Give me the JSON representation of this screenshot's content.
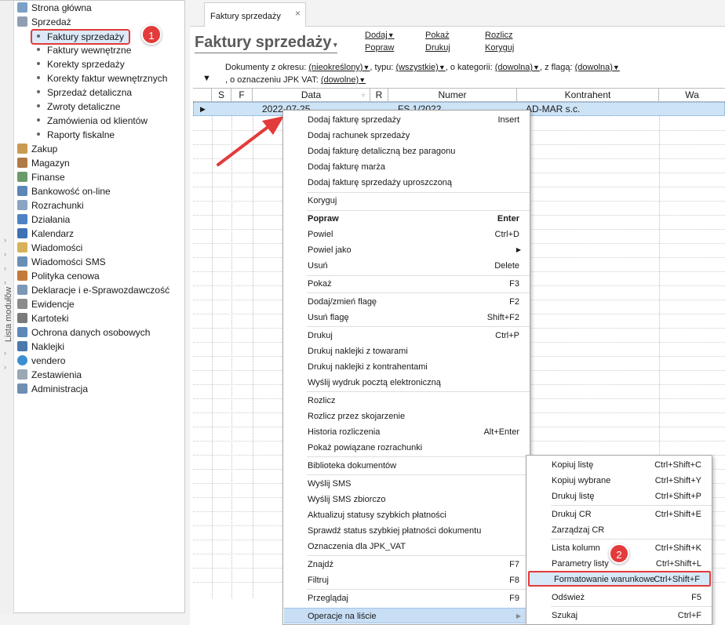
{
  "sidebar": {
    "rail_label": "Lista modułów",
    "modules": [
      {
        "label": "Strona główna",
        "icon": "home-icon"
      },
      {
        "label": "Sprzedaż",
        "icon": "sales-icon"
      },
      {
        "label": "Zakup",
        "icon": "purchase-icon"
      },
      {
        "label": "Magazyn",
        "icon": "warehouse-icon"
      },
      {
        "label": "Finanse",
        "icon": "finance-icon"
      },
      {
        "label": "Bankowość on-line",
        "icon": "bank-icon"
      },
      {
        "label": "Rozrachunki",
        "icon": "settlements-icon"
      },
      {
        "label": "Działania",
        "icon": "actions-icon"
      },
      {
        "label": "Kalendarz",
        "icon": "calendar-icon"
      },
      {
        "label": "Wiadomości",
        "icon": "mail-icon"
      },
      {
        "label": "Wiadomości SMS",
        "icon": "sms-icon"
      },
      {
        "label": "Polityka cenowa",
        "icon": "price-icon"
      },
      {
        "label": "Deklaracje i e-Sprawozdawczość",
        "icon": "declarations-icon"
      },
      {
        "label": "Ewidencje",
        "icon": "records-icon"
      },
      {
        "label": "Kartoteki",
        "icon": "files-icon"
      },
      {
        "label": "Ochrona danych osobowych",
        "icon": "privacy-icon"
      },
      {
        "label": "Naklejki",
        "icon": "stickers-icon"
      },
      {
        "label": "vendero",
        "icon": "vendero-icon"
      },
      {
        "label": "Zestawienia",
        "icon": "reports-icon"
      },
      {
        "label": "Administracja",
        "icon": "admin-icon"
      }
    ],
    "sales_items": [
      "Faktury sprzedaży",
      "Faktury wewnętrzne",
      "Korekty sprzedaży",
      "Korekty faktur wewnętrznych",
      "Sprzedaż detaliczna",
      "Zwroty detaliczne",
      "Zamówienia od klientów",
      "Raporty fiskalne"
    ]
  },
  "badges": {
    "first": "1",
    "second": "2"
  },
  "tab": {
    "label": "Faktury sprzedaży",
    "close": "×"
  },
  "main": {
    "title": "Faktury sprzedaży",
    "toolbar": [
      "Dodaj",
      "Popraw",
      "Pokaż",
      "Drukuj",
      "Rozlicz",
      "Koryguj"
    ],
    "filter_line1": {
      "label_period": "Dokumenty z okresu:",
      "period": "(nieokreślony)",
      "label_type": ", typu:",
      "type": "(wszystkie)",
      "label_category": ", o kategorii:",
      "category": "(dowolna)",
      "label_flag": ", z flagą:",
      "flag": "(dowolna)"
    },
    "filter_line2": {
      "label_jpk": ", o oznaczeniu JPK VAT:",
      "jpk": "(dowolne)"
    }
  },
  "grid": {
    "columns": [
      "S",
      "F",
      "Data",
      "R",
      "Numer",
      "Kontrahent",
      "Wa"
    ],
    "rows": [
      {
        "data": "2022-07-25",
        "numer": "FS 1/2022",
        "kontrahent": "AD-MAR s.c."
      }
    ]
  },
  "context_menu": {
    "items": [
      {
        "label": "Dodaj fakturę sprzedaży",
        "shortcut": "Insert"
      },
      {
        "label": "Dodaj rachunek sprzedaży",
        "shortcut": ""
      },
      {
        "label": "Dodaj fakturę detaliczną bez paragonu",
        "shortcut": ""
      },
      {
        "label": "Dodaj fakturę marża",
        "shortcut": ""
      },
      {
        "label": "Dodaj fakturę sprzedaży uproszczoną",
        "shortcut": ""
      },
      {
        "label": "Koryguj",
        "shortcut": ""
      },
      {
        "label": "Popraw",
        "shortcut": "Enter"
      },
      {
        "label": "Powiel",
        "shortcut": "Ctrl+D"
      },
      {
        "label": "Powiel jako",
        "shortcut": ""
      },
      {
        "label": "Usuń",
        "shortcut": "Delete"
      },
      {
        "label": "Pokaż",
        "shortcut": "F3"
      },
      {
        "label": "Dodaj/zmień flagę",
        "shortcut": "F2"
      },
      {
        "label": "Usuń flagę",
        "shortcut": "Shift+F2"
      },
      {
        "label": "Drukuj",
        "shortcut": "Ctrl+P"
      },
      {
        "label": "Drukuj naklejki z towarami",
        "shortcut": ""
      },
      {
        "label": "Drukuj naklejki z kontrahentami",
        "shortcut": ""
      },
      {
        "label": "Wyślij wydruk pocztą elektroniczną",
        "shortcut": ""
      },
      {
        "label": "Rozlicz",
        "shortcut": ""
      },
      {
        "label": "Rozlicz przez skojarzenie",
        "shortcut": ""
      },
      {
        "label": "Historia rozliczenia",
        "shortcut": "Alt+Enter"
      },
      {
        "label": "Pokaż powiązane rozrachunki",
        "shortcut": ""
      },
      {
        "label": "Biblioteka dokumentów",
        "shortcut": ""
      },
      {
        "label": "Wyślij SMS",
        "shortcut": ""
      },
      {
        "label": "Wyślij SMS zbiorczo",
        "shortcut": ""
      },
      {
        "label": "Aktualizuj statusy szybkich płatności",
        "shortcut": ""
      },
      {
        "label": "Sprawdź status szybkiej płatności dokumentu",
        "shortcut": ""
      },
      {
        "label": "Oznaczenia dla JPK_VAT",
        "shortcut": ""
      },
      {
        "label": "Znajdź",
        "shortcut": "F7"
      },
      {
        "label": "Filtruj",
        "shortcut": "F8"
      },
      {
        "label": "Przeglądaj",
        "shortcut": "F9"
      },
      {
        "label": "Operacje na liście",
        "shortcut": ""
      }
    ]
  },
  "submenu": {
    "items": [
      {
        "label": "Kopiuj listę",
        "shortcut": "Ctrl+Shift+C"
      },
      {
        "label": "Kopiuj wybrane",
        "shortcut": "Ctrl+Shift+Y"
      },
      {
        "label": "Drukuj listę",
        "shortcut": "Ctrl+Shift+P"
      },
      {
        "label": "Drukuj CR",
        "shortcut": "Ctrl+Shift+E"
      },
      {
        "label": "Zarządzaj CR",
        "shortcut": ""
      },
      {
        "label": "Lista kolumn",
        "shortcut": "Ctrl+Shift+K"
      },
      {
        "label": "Parametry listy",
        "shortcut": "Ctrl+Shift+L"
      },
      {
        "label": "Formatowanie warunkowe",
        "shortcut": "Ctrl+Shift+F"
      },
      {
        "label": "Odśwież",
        "shortcut": "F5"
      },
      {
        "label": "Szukaj",
        "shortcut": "Ctrl+F"
      }
    ]
  },
  "colors": {
    "accent_red": "#e33b3b",
    "selection": "#cde3f6"
  }
}
